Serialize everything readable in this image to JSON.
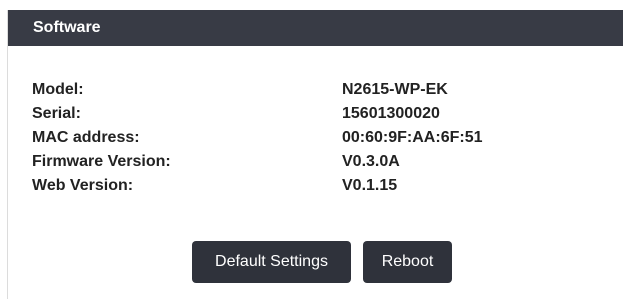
{
  "panel": {
    "title": "Software"
  },
  "info": {
    "rows": [
      {
        "label": "Model:",
        "value": "N2615-WP-EK"
      },
      {
        "label": "Serial:",
        "value": "15601300020"
      },
      {
        "label": "MAC address:",
        "value": "00:60:9F:AA:6F:51"
      },
      {
        "label": "Firmware Version:",
        "value": "V0.3.0A"
      },
      {
        "label": "Web Version:",
        "value": "V0.1.15"
      }
    ]
  },
  "actions": {
    "default_settings_label": "Default Settings",
    "reboot_label": "Reboot"
  },
  "colors": {
    "header_bg": "#383b45",
    "button_bg": "#2f323b",
    "text": "#222222"
  }
}
